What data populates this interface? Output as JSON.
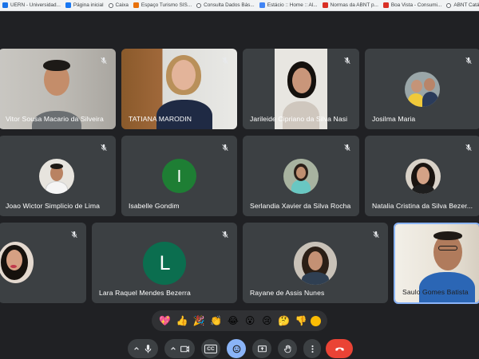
{
  "bookmarks": [
    {
      "label": "UERN - Universidad...",
      "color": "#1a73e8"
    },
    {
      "label": "Página inicial",
      "color": "#1877f2"
    },
    {
      "label": "Caixa",
      "color": "globe"
    },
    {
      "label": "Espaço Turismo SIS...",
      "color": "#e8710a"
    },
    {
      "label": "Consulta Dados Bás...",
      "color": "globe"
    },
    {
      "label": "Estácio :: Home :: Al...",
      "color": "#4285f4"
    },
    {
      "label": "Normas da ABNT p...",
      "color": "#d93025"
    },
    {
      "label": "Boa Vista - Consumi...",
      "color": "#d93025"
    },
    {
      "label": "ABNT Catálogo",
      "color": "globe"
    }
  ],
  "participants": {
    "vitor": {
      "name": "Vitor Sousa Macario da Silveira",
      "muted": true
    },
    "tatiana": {
      "name": "TATIANA MARODIN",
      "muted": true
    },
    "jarileide": {
      "name": "Jarileide Cipriano da Silva Nasi",
      "muted": true
    },
    "josilma": {
      "name": "Josilma Maria",
      "muted": true
    },
    "joao": {
      "name": "Joao Wictor Simplicio de Lima",
      "muted": true
    },
    "isabelle": {
      "name": "Isabelle Gondim",
      "muted": true,
      "initial": "I",
      "color": "#1e7e34"
    },
    "serlandia": {
      "name": "Serlandia Xavier da Silva Rocha",
      "muted": true
    },
    "natalia": {
      "name": "Natalia Cristina da Silva Bezer...",
      "muted": true
    },
    "unnamed": {
      "muted": true
    },
    "lara": {
      "name": "Lara Raquel Mendes Bezerra",
      "muted": true,
      "initial": "L",
      "color": "#0b6e4f"
    },
    "rayane": {
      "name": "Rayane de Assis Nunes",
      "muted": true
    },
    "saulo": {
      "name": "Saulo Gomes Batista",
      "muted": false
    }
  },
  "reactions": [
    "💖",
    "👍",
    "🎉",
    "👏",
    "😂",
    "😮",
    "😢",
    "🤔",
    "👎"
  ],
  "controls": {
    "mic": "microphone-icon",
    "camera": "camera-icon",
    "captions_label": "CC",
    "emoji": "emoji-icon",
    "present": "present-screen-icon",
    "raise_hand": "hand-icon",
    "more": "more-vert-icon",
    "end_call": "end-call-icon"
  },
  "colors": {
    "background": "#202124",
    "tile": "#3c4043",
    "end_call": "#ea4335",
    "active": "#8ab4f8"
  }
}
